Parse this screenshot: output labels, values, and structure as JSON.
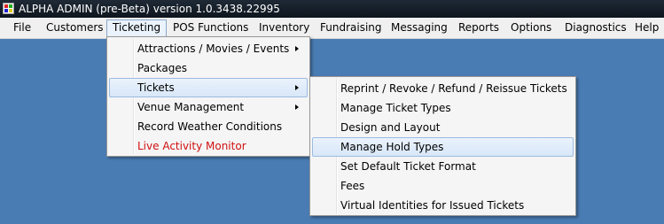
{
  "window": {
    "title": "ALPHA ADMIN (pre-Beta) version 1.0.3438.22995"
  },
  "menubar": {
    "items": [
      "File",
      "Customers",
      "Ticketing",
      "POS Functions",
      "Inventory",
      "Fundraising",
      "Messaging",
      "Reports",
      "Options",
      "Diagnostics",
      "Help"
    ],
    "open_item": "Ticketing"
  },
  "ticketing_menu": {
    "items": [
      {
        "label": "Attractions / Movies /  Events",
        "submenu": true
      },
      {
        "label": "Packages",
        "submenu": false
      },
      {
        "label": "Tickets",
        "submenu": true,
        "highlighted": true
      },
      {
        "label": "Venue Management",
        "submenu": true
      },
      {
        "label": "Record Weather Conditions",
        "submenu": false
      },
      {
        "label": "Live Activity Monitor",
        "submenu": false,
        "color": "#d01010"
      }
    ]
  },
  "tickets_submenu": {
    "items": [
      {
        "label": "Reprint / Revoke / Refund / Reissue Tickets"
      },
      {
        "label": "Manage Ticket Types"
      },
      {
        "label": "Design and Layout"
      },
      {
        "label": "Manage Hold Types",
        "highlighted": true
      },
      {
        "label": "Set Default Ticket Format"
      },
      {
        "label": "Fees"
      },
      {
        "label": "Virtual Identities for Issued Tickets"
      }
    ]
  },
  "colors": {
    "desktop_background": "#4a7cb4",
    "menu_highlight": "#d8e7f8",
    "live_monitor_text": "#d01010"
  }
}
